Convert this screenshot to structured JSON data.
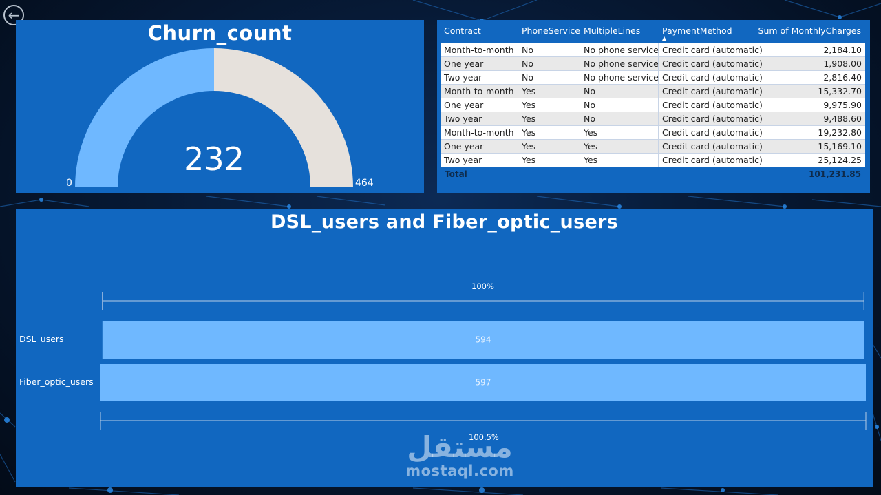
{
  "gauge": {
    "title": "Churn_count",
    "value": 232,
    "min": 0,
    "max": 464,
    "colors": {
      "fill": "#6fb8ff",
      "remainder": "#e6e1dc"
    }
  },
  "table": {
    "columns": [
      "Contract",
      "PhoneService",
      "MultipleLines",
      "PaymentMethod",
      "Sum of MonthlyCharges"
    ],
    "sorted_column": "PaymentMethod",
    "rows": [
      [
        "Month-to-month",
        "No",
        "No phone service",
        "Credit card (automatic)",
        "2,184.10"
      ],
      [
        "One year",
        "No",
        "No phone service",
        "Credit card (automatic)",
        "1,908.00"
      ],
      [
        "Two year",
        "No",
        "No phone service",
        "Credit card (automatic)",
        "2,816.40"
      ],
      [
        "Month-to-month",
        "Yes",
        "No",
        "Credit card (automatic)",
        "15,332.70"
      ],
      [
        "One year",
        "Yes",
        "No",
        "Credit card (automatic)",
        "9,975.90"
      ],
      [
        "Two year",
        "Yes",
        "No",
        "Credit card (automatic)",
        "9,488.60"
      ],
      [
        "Month-to-month",
        "Yes",
        "Yes",
        "Credit card (automatic)",
        "19,232.80"
      ],
      [
        "One year",
        "Yes",
        "Yes",
        "Credit card (automatic)",
        "15,169.10"
      ],
      [
        "Two year",
        "Yes",
        "Yes",
        "Credit card (automatic)",
        "25,124.25"
      ]
    ],
    "total_label": "Total",
    "total_value": "101,231.85"
  },
  "chart_data": {
    "type": "bar",
    "title": "DSL_users and Fiber_optic_users",
    "categories": [
      "DSL_users",
      "Fiber_optic_users"
    ],
    "values": [
      594,
      597
    ],
    "data_labels": [
      "594",
      "597"
    ],
    "top_scale_label": "100%",
    "bottom_scale_label": "100.5%",
    "bar_color": "#6fb8ff"
  },
  "watermark": {
    "arabic": "مستقل",
    "latin": "mostaql.com"
  },
  "icons": {
    "back": "back-arrow-icon"
  }
}
